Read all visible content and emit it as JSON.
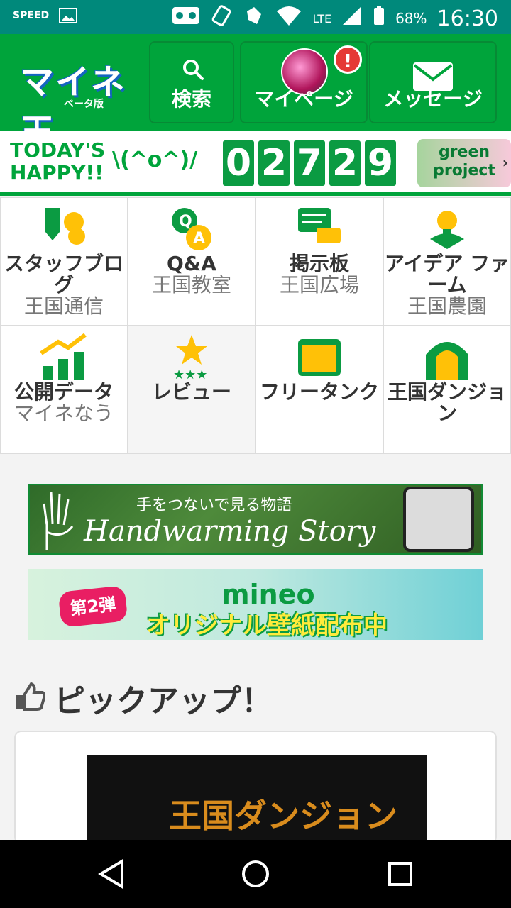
{
  "status_bar": {
    "battery": "68%",
    "network": "LTE",
    "time": "16:30",
    "left_label": "SPEED"
  },
  "header": {
    "logo_text": "マイネ王",
    "logo_sub": "ベータ版",
    "search_label": "検索",
    "mypage_label": "マイページ",
    "mypage_badge": "!",
    "message_label": "メッセージ"
  },
  "happy": {
    "line1": "TODAY'S",
    "line2": "HAPPY!!",
    "face": "\\(^o^)/",
    "digits": [
      "0",
      "2",
      "7",
      "2",
      "9"
    ],
    "green_project_line1": "green",
    "green_project_line2": "project"
  },
  "grid": {
    "cells": [
      {
        "title": "スタッフブログ",
        "sub": "王国通信"
      },
      {
        "title": "Q&A",
        "sub": "王国教室"
      },
      {
        "title": "掲示板",
        "sub": "王国広場"
      },
      {
        "title": "アイデア ファーム",
        "sub": "王国農園"
      },
      {
        "title": "公開データ",
        "sub": "マイネなう"
      },
      {
        "title": "レビュー",
        "sub": ""
      },
      {
        "title": "フリータンク",
        "sub": ""
      },
      {
        "title": "王国ダンジョン",
        "sub": ""
      }
    ]
  },
  "banners": {
    "b1_top": "手をつないで見る物語",
    "b1_big": "Handwarming Story",
    "b2_tag": "第2弾",
    "b2_brand": "mineo",
    "b2_text": "オリジナル壁紙配布中"
  },
  "pickup": {
    "title": "ピックアップ！",
    "card_image_text": "王国ダンジョン"
  },
  "colors": {
    "status_bar": "#00897b",
    "header_green": "#00a43b",
    "badge_red": "#e53935",
    "accent_yellow": "#ffc107"
  }
}
